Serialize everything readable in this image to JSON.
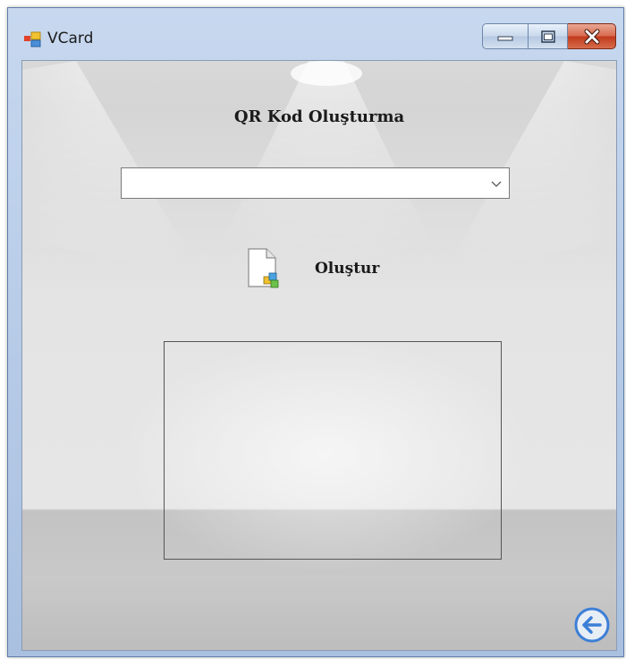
{
  "window": {
    "title": "VCard"
  },
  "icons": {
    "app": "app-window-icon",
    "minimize": "minimize-icon",
    "maximize": "maximize-icon",
    "close": "close-icon",
    "dropdown": "chevron-down-icon",
    "create": "document-add-icon",
    "back": "back-arrow-icon"
  },
  "form": {
    "heading": "QR Kod Oluşturma",
    "combo_value": "",
    "create_label": "Oluştur"
  },
  "colors": {
    "close_button": "#c7452b",
    "back_icon": "#3d7fd6"
  }
}
